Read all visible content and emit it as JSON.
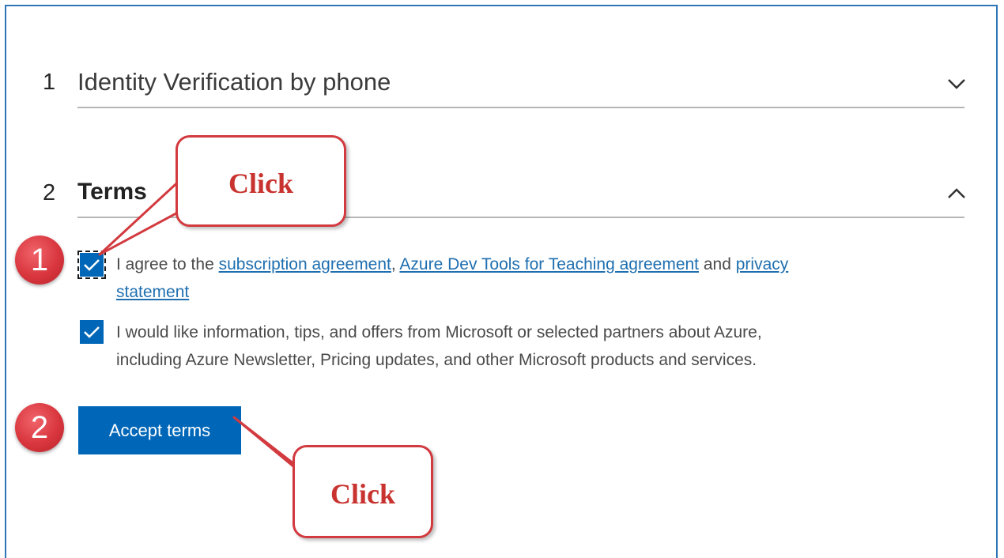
{
  "steps": [
    {
      "number": "1",
      "title": "Identity Verification by phone",
      "state": "collapsed",
      "chevron_icon": "chevron-down-icon"
    },
    {
      "number": "2",
      "title": "Terms",
      "state": "expanded",
      "chevron_icon": "chevron-up-icon"
    }
  ],
  "terms": {
    "agree": {
      "checked": true,
      "text_before": "I agree to the ",
      "link_subscription": "subscription agreement",
      "sep": ", ",
      "link_devtools": "Azure Dev Tools for Teaching agreement",
      "and_text": " and ",
      "link_privacy_1": "privacy",
      "link_privacy_2": "statement"
    },
    "marketing": {
      "checked": true,
      "line1": "I would like information, tips, and offers from Microsoft or selected partners about Azure,",
      "line2": "including Azure Newsletter, Pricing updates, and other Microsoft products and services."
    },
    "accept_button": "Accept terms"
  },
  "annotations": {
    "badge_1": "1",
    "badge_2": "2",
    "callout_top": "Click",
    "callout_bottom": "Click"
  },
  "colors": {
    "accent_blue": "#0067b8",
    "link_blue": "#1f6fb0",
    "annotation_red": "#d23a3f",
    "frame_blue": "#2e75b6"
  }
}
